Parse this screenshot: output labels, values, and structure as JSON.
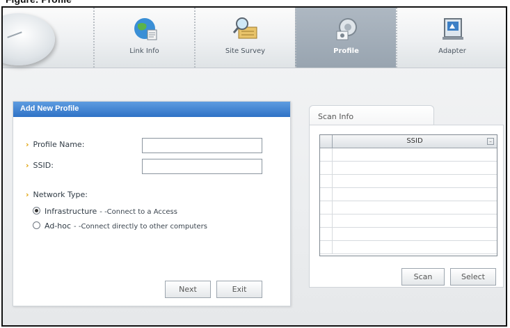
{
  "tabs": [
    {
      "label": "Link Info",
      "active": false
    },
    {
      "label": "Site Survey",
      "active": false
    },
    {
      "label": "Profile",
      "active": true
    },
    {
      "label": "Adapter",
      "active": false
    }
  ],
  "add_profile": {
    "title": "Add New Profile",
    "profile_name_label": "Profile Name:",
    "profile_name_value": "",
    "ssid_label": "SSID:",
    "ssid_value": "",
    "network_type_label": "Network Type:",
    "options": [
      {
        "label": "Infrastructure",
        "desc": "- -Connect to a Access",
        "selected": true
      },
      {
        "label": "Ad-hoc",
        "desc": "- -Connect directly to other computers",
        "selected": false
      }
    ],
    "next_button": "Next",
    "exit_button": "Exit"
  },
  "scan_info": {
    "tab_label": "Scan Info",
    "column_header": "SSID",
    "rows": [
      "",
      "",
      "",
      "",
      "",
      "",
      "",
      ""
    ],
    "scan_button": "Scan",
    "select_button": "Select"
  },
  "colors": {
    "title_bar": "#2f72c6",
    "active_tab": "#98a4b0",
    "accent_arrow": "#e0a000"
  }
}
